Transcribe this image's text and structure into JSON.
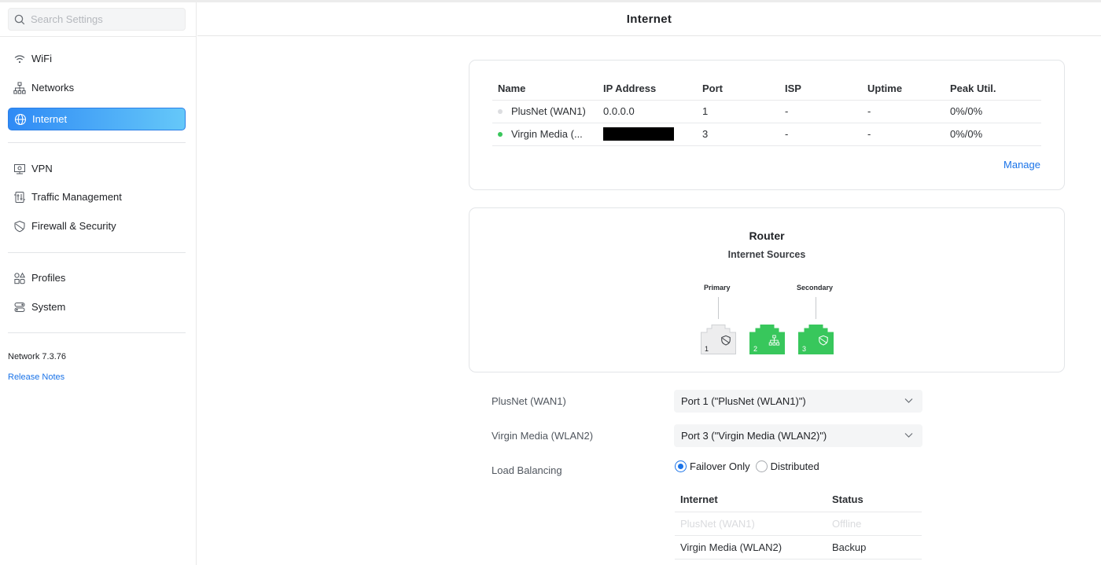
{
  "search": {
    "placeholder": "Search Settings"
  },
  "sidebar": {
    "items": [
      {
        "label": "WiFi",
        "icon": "wifi-icon"
      },
      {
        "label": "Networks",
        "icon": "network-tree-icon"
      },
      {
        "label": "Internet",
        "icon": "globe-icon",
        "active": true
      },
      {
        "label": "VPN",
        "icon": "vpn-icon"
      },
      {
        "label": "Traffic Management",
        "icon": "traffic-icon"
      },
      {
        "label": "Firewall & Security",
        "icon": "shield-icon"
      },
      {
        "label": "Profiles",
        "icon": "profiles-icon"
      },
      {
        "label": "System",
        "icon": "system-icon"
      }
    ],
    "version": "Network 7.3.76",
    "release_notes": "Release Notes"
  },
  "header": {
    "title": "Internet"
  },
  "wan_table": {
    "columns": [
      "Name",
      "IP Address",
      "Port",
      "ISP",
      "Uptime",
      "Peak Util."
    ],
    "rows": [
      {
        "name": "PlusNet (WAN1)",
        "status": "offline",
        "ip": "0.0.0.0",
        "port": "1",
        "isp": "-",
        "uptime": "-",
        "peak": "0%/0%"
      },
      {
        "name": "Virgin Media (...",
        "status": "online",
        "ip": "",
        "port": "3",
        "isp": "-",
        "uptime": "-",
        "peak": "0%/0%"
      }
    ],
    "manage_label": "Manage"
  },
  "router": {
    "title": "Router",
    "subtitle": "Internet Sources",
    "primary_label": "Primary",
    "secondary_label": "Secondary",
    "ports": [
      {
        "number": "1",
        "type": "wan",
        "active": false,
        "icon": "shield-icon"
      },
      {
        "number": "2",
        "type": "lan",
        "active": true,
        "icon": "network-tree-icon"
      },
      {
        "number": "3",
        "type": "wan",
        "active": true,
        "icon": "shield-icon"
      }
    ],
    "colors": {
      "active": "#38c75c",
      "inactive": "#ededee"
    }
  },
  "settings": {
    "wan1_label": "PlusNet (WAN1)",
    "wan1_value": "Port 1 (\"PlusNet (WLAN1)\")",
    "wan2_label": "Virgin Media (WLAN2)",
    "wan2_value": "Port 3 (\"Virgin Media (WLAN2)\")",
    "load_balancing_label": "Load Balancing",
    "options": [
      "Failover Only",
      "Distributed"
    ],
    "selected_option": "Failover Only"
  },
  "lb_table": {
    "columns": [
      "Internet",
      "Status"
    ],
    "rows": [
      {
        "internet": "PlusNet (WAN1)",
        "status": "Offline",
        "dim": true
      },
      {
        "internet": "Virgin Media (WLAN2)",
        "status": "Backup",
        "dim": false
      }
    ]
  }
}
